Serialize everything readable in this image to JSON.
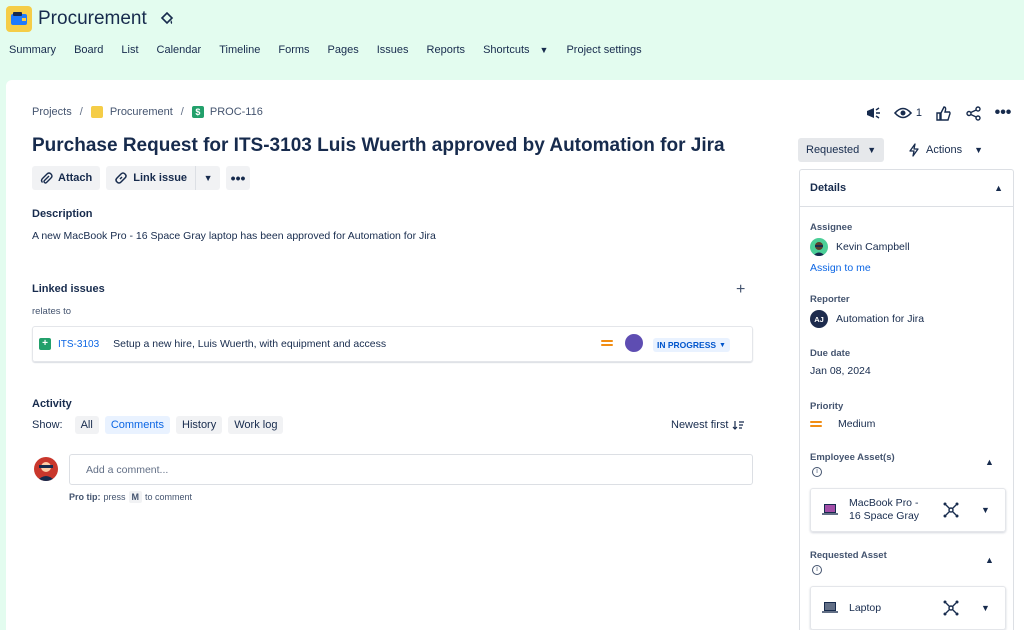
{
  "project": {
    "name": "Procurement"
  },
  "nav": {
    "tabs": [
      "Summary",
      "Board",
      "List",
      "Calendar",
      "Timeline",
      "Forms",
      "Pages",
      "Issues",
      "Reports",
      "Shortcuts",
      "Project settings"
    ]
  },
  "breadcrumbs": {
    "projects": "Projects",
    "project": "Procurement",
    "issue_key": "PROC-116"
  },
  "header_actions": {
    "watch_count": "1"
  },
  "issue": {
    "title": "Purchase Request for ITS-3103 Luis Wuerth approved by Automation for Jira",
    "buttons": {
      "attach": "Attach",
      "link_issue": "Link issue"
    },
    "description_heading": "Description",
    "description": "A new MacBook Pro - 16 Space Gray laptop has been approved for Automation for Jira",
    "linked_heading": "Linked issues",
    "relates_to": "relates to",
    "linked": {
      "key": "ITS-3103",
      "summary": "Setup a new hire, Luis Wuerth, with equipment and access",
      "status": "IN PROGRESS"
    }
  },
  "activity": {
    "heading": "Activity",
    "show_label": "Show:",
    "filters": [
      "All",
      "Comments",
      "History",
      "Work log"
    ],
    "active_filter": "Comments",
    "sort": "Newest first",
    "comment_placeholder": "Add a comment...",
    "protip_bold": "Pro tip:",
    "protip_press": "press",
    "protip_key": "M",
    "protip_tail": "to comment"
  },
  "sidebar": {
    "status": "Requested",
    "actions": "Actions",
    "details_heading": "Details",
    "assignee_label": "Assignee",
    "assignee": "Kevin Campbell",
    "assign_me": "Assign to me",
    "reporter_label": "Reporter",
    "reporter": "Automation for Jira",
    "reporter_initials": "AJ",
    "due_label": "Due date",
    "due": "Jan 08, 2024",
    "priority_label": "Priority",
    "priority": "Medium",
    "employee_assets_label": "Employee Asset(s)",
    "employee_asset_line1": "MacBook Pro -",
    "employee_asset_line2": "16 Space Gray",
    "requested_asset_label": "Requested Asset",
    "requested_asset": "Laptop"
  },
  "colors": {
    "brand_bg": "#e3fcef",
    "link": "#0c66e4",
    "priority_medium": "#f18d13",
    "story_green": "#22a06b"
  }
}
